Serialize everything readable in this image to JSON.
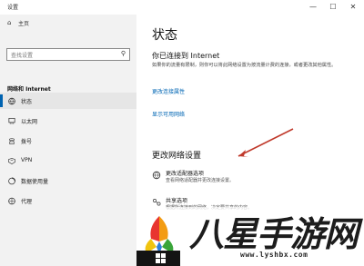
{
  "window": {
    "title": "设置",
    "minimize": "—",
    "maximize": "☐",
    "close": "✕"
  },
  "sidebar": {
    "home_label": "主页",
    "search_placeholder": "查找设置",
    "section_title": "网络和 Internet",
    "items": [
      {
        "label": "状态",
        "icon": "globe-icon"
      },
      {
        "label": "以太网",
        "icon": "ethernet-icon"
      },
      {
        "label": "拨号",
        "icon": "dialup-icon"
      },
      {
        "label": "VPN",
        "icon": "vpn-icon"
      },
      {
        "label": "数据使用量",
        "icon": "data-usage-icon"
      },
      {
        "label": "代理",
        "icon": "proxy-icon"
      }
    ]
  },
  "main": {
    "heading": "状态",
    "connection_title": "你已连接到 Internet",
    "connection_desc": "如果你的流量有限制，则你可以将此网络设置为按流量计费的连接，或者更改其他属性。",
    "link_change_properties": "更改连接属性",
    "link_show_networks": "显示可用网络",
    "section_change": "更改网络设置",
    "options": [
      {
        "title": "更改适配器选项",
        "desc": "查看网络适配器并更改连接设置。",
        "icon": "adapter-icon"
      },
      {
        "title": "共享选项",
        "desc": "根据所连接到的网络，决定要共享的内容。",
        "icon": "sharing-icon"
      }
    ]
  },
  "watermark": {
    "text": "八星手游网",
    "url": "www.lyshbx.com"
  },
  "colors": {
    "accent": "#0063b1",
    "link": "#0066b4",
    "sidebar_bg": "#f2f2f2",
    "annotation_arrow": "#c0392b"
  }
}
